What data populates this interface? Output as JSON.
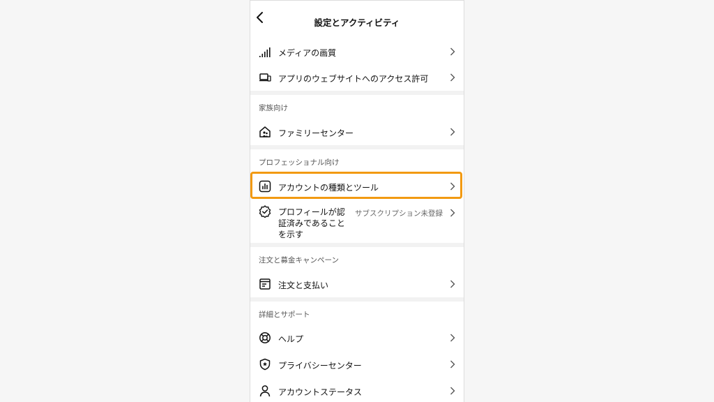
{
  "header": {
    "title": "設定とアクティビティ"
  },
  "rows_top": [
    {
      "label": "メディアの画質",
      "icon": "signal-bars-icon"
    },
    {
      "label": "アプリのウェブサイトへのアクセス許可",
      "icon": "laptop-icon"
    }
  ],
  "sections": {
    "family": "家族向け",
    "professional": "プロフェッショナル向け",
    "orders": "注文と募金キャンペーン",
    "support": "詳細とサポート"
  },
  "family_center": {
    "label": "ファミリーセンター",
    "icon": "family-home-icon"
  },
  "account_tools": {
    "label": "アカウントの種類とツール",
    "icon": "chart-box-icon"
  },
  "verified": {
    "label": "プロフィールが認証済みであることを示す",
    "status": "サブスクリプション未登録",
    "icon": "verified-badge-icon"
  },
  "orders_payments": {
    "label": "注文と支払い",
    "icon": "receipt-icon"
  },
  "help": {
    "label": "ヘルプ",
    "icon": "lifebuoy-icon"
  },
  "privacy_center": {
    "label": "プライバシーセンター",
    "icon": "shield-star-icon"
  },
  "account_status": {
    "label": "アカウントステータス",
    "icon": "person-icon"
  },
  "highlight_color": "#f29a12"
}
